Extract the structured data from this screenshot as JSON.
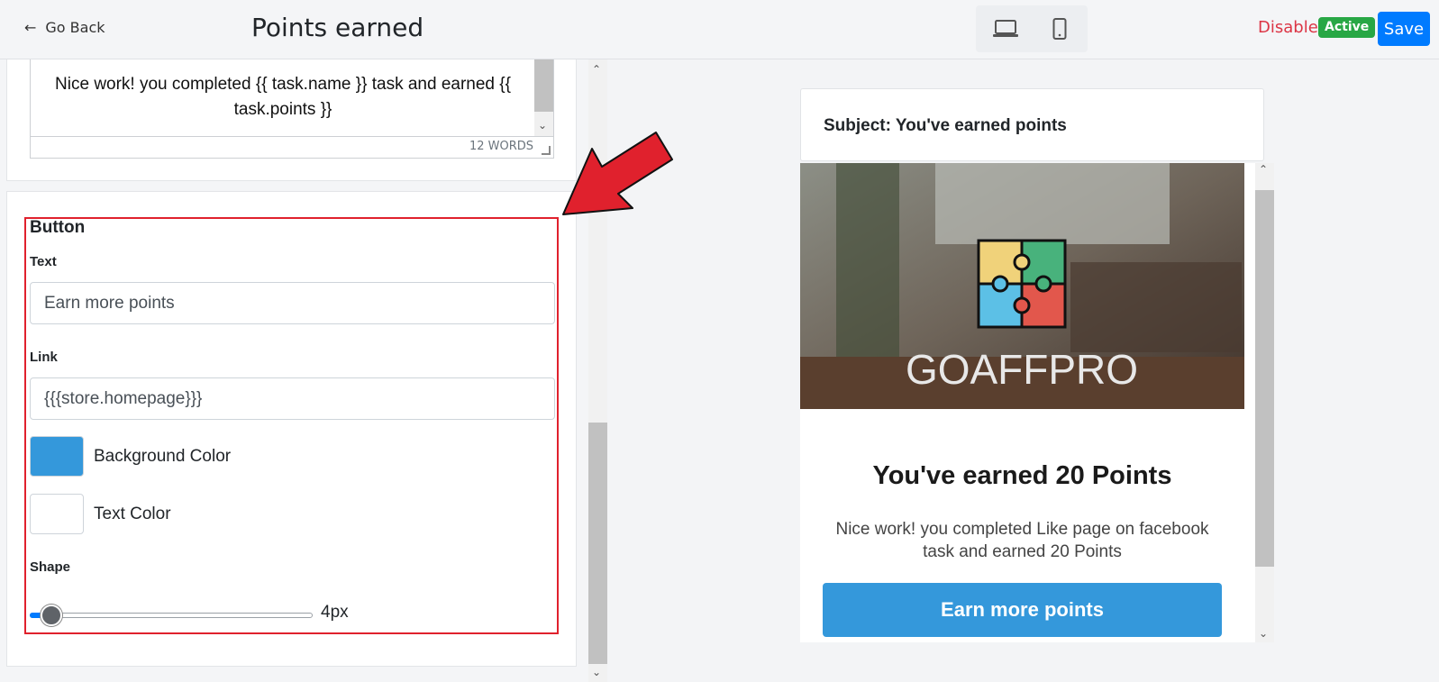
{
  "header": {
    "back_label": "Go Back",
    "title": "Points earned",
    "devices": [
      "laptop-icon",
      "phone-icon"
    ],
    "disable_label": "Disable",
    "status_badge": "Active",
    "save_label": "Save"
  },
  "editor": {
    "content": "Nice work! you completed {{ task.name }} task and earned {{ task.points }}",
    "word_count": "12 WORDS"
  },
  "button_settings": {
    "section_title": "Button",
    "text_label": "Text",
    "text_value": "Earn more points",
    "link_label": "Link",
    "link_value": "{{{store.homepage}}}",
    "background_color_label": "Background Color",
    "background_color": "#3498db",
    "text_color_label": "Text Color",
    "text_color": "#ffffff",
    "shape_label": "Shape",
    "shape_value": "4px"
  },
  "preview": {
    "subject": "Subject: You've earned points",
    "hero_brand": "GOAFFPRO",
    "heading": "You've earned 20 Points",
    "body": "Nice work! you completed Like page on facebook task and earned 20 Points",
    "button_label": "Earn more points"
  },
  "colors": {
    "accent_blue": "#007bff",
    "danger_red": "#dc3545",
    "success_green": "#28a745",
    "annotation_red": "#e0212d"
  }
}
